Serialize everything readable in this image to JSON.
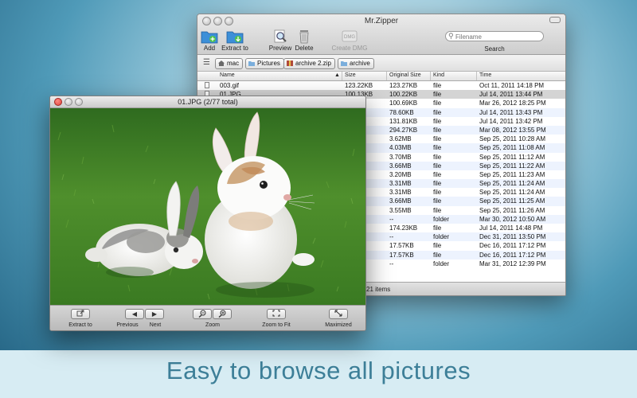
{
  "caption": "Easy to browse all pictures",
  "zipper": {
    "title": "Mr.Zipper",
    "toolbar": {
      "add": "Add",
      "extract_to": "Extract to",
      "preview": "Preview",
      "delete": "Delete",
      "create_dmg": "Create DMG",
      "dmg_badge": "DMG",
      "search_placeholder": "Filename",
      "search_label": "Search"
    },
    "path": [
      "mac",
      "Pictures",
      "archive 2.zip",
      "archive"
    ],
    "columns": {
      "name": "Name",
      "size": "Size",
      "original_size": "Original Size",
      "kind": "Kind",
      "time": "Time"
    },
    "rows": [
      {
        "name": "003.gif",
        "size": "123.22KB",
        "original": "123.27KB",
        "kind": "file",
        "time": "Oct 11, 2011 14:18 PM"
      },
      {
        "name": "01.JPG",
        "size": "100.13KB",
        "original": "100.22KB",
        "kind": "file",
        "time": "Jul 14, 2011 13:44 PM"
      },
      {
        "name": "",
        "size": "KB",
        "original": "100.69KB",
        "kind": "file",
        "time": "Mar 26, 2012 18:25 PM"
      },
      {
        "name": "",
        "size": "KB",
        "original": "78.60KB",
        "kind": "file",
        "time": "Jul 14, 2011 13:43 PM"
      },
      {
        "name": "",
        "size": "KB",
        "original": "131.81KB",
        "kind": "file",
        "time": "Jul 14, 2011 13:42 PM"
      },
      {
        "name": "",
        "size": "KB",
        "original": "294.27KB",
        "kind": "file",
        "time": "Mar 08, 2012 13:55 PM"
      },
      {
        "name": "",
        "size": "",
        "original": "3.62MB",
        "kind": "file",
        "time": "Sep 25, 2011 10:28 AM"
      },
      {
        "name": "",
        "size": "",
        "original": "4.03MB",
        "kind": "file",
        "time": "Sep 25, 2011 11:08 AM"
      },
      {
        "name": "",
        "size": "",
        "original": "3.70MB",
        "kind": "file",
        "time": "Sep 25, 2011 11:12 AM"
      },
      {
        "name": "",
        "size": "",
        "original": "3.66MB",
        "kind": "file",
        "time": "Sep 25, 2011 11:22 AM"
      },
      {
        "name": "",
        "size": "",
        "original": "3.20MB",
        "kind": "file",
        "time": "Sep 25, 2011 11:23 AM"
      },
      {
        "name": "",
        "size": "",
        "original": "3.31MB",
        "kind": "file",
        "time": "Sep 25, 2011 11:24 AM"
      },
      {
        "name": "",
        "size": "",
        "original": "3.31MB",
        "kind": "file",
        "time": "Sep 25, 2011 11:24 AM"
      },
      {
        "name": "",
        "size": "",
        "original": "3.66MB",
        "kind": "file",
        "time": "Sep 25, 2011 11:25 AM"
      },
      {
        "name": "",
        "size": "",
        "original": "3.55MB",
        "kind": "file",
        "time": "Sep 25, 2011 11:26 AM"
      },
      {
        "name": "",
        "size": "",
        "original": "--",
        "kind": "folder",
        "time": "Mar 30, 2012 10:50 AM"
      },
      {
        "name": "",
        "size": "KB",
        "original": "174.23KB",
        "kind": "file",
        "time": "Jul 14, 2011 14:48 PM"
      },
      {
        "name": "",
        "size": "",
        "original": "--",
        "kind": "folder",
        "time": "Dec 31, 2011 13:50 PM"
      },
      {
        "name": "",
        "size": "",
        "original": "17.57KB",
        "kind": "file",
        "time": "Dec 16, 2011 17:12 PM"
      },
      {
        "name": "",
        "size": "",
        "original": "17.57KB",
        "kind": "file",
        "time": "Dec 16, 2011 17:12 PM"
      },
      {
        "name": "",
        "size": "",
        "original": "--",
        "kind": "folder",
        "time": "Mar 31, 2012 12:39 PM"
      }
    ],
    "status": "21 items"
  },
  "viewer": {
    "title": "01.JPG  (2/77 total)",
    "buttons": {
      "extract_to": "Extract to",
      "previous": "Previous",
      "next": "Next",
      "zoom": "Zoom",
      "zoom_to_fit": "Zoom to Fit",
      "maximized": "Maximized"
    }
  },
  "colors": {
    "caption": "#3d7f98",
    "selected_row": "#d4d4d4",
    "close_light": "#e0443e",
    "folder_blue": "#3c8fd8"
  }
}
